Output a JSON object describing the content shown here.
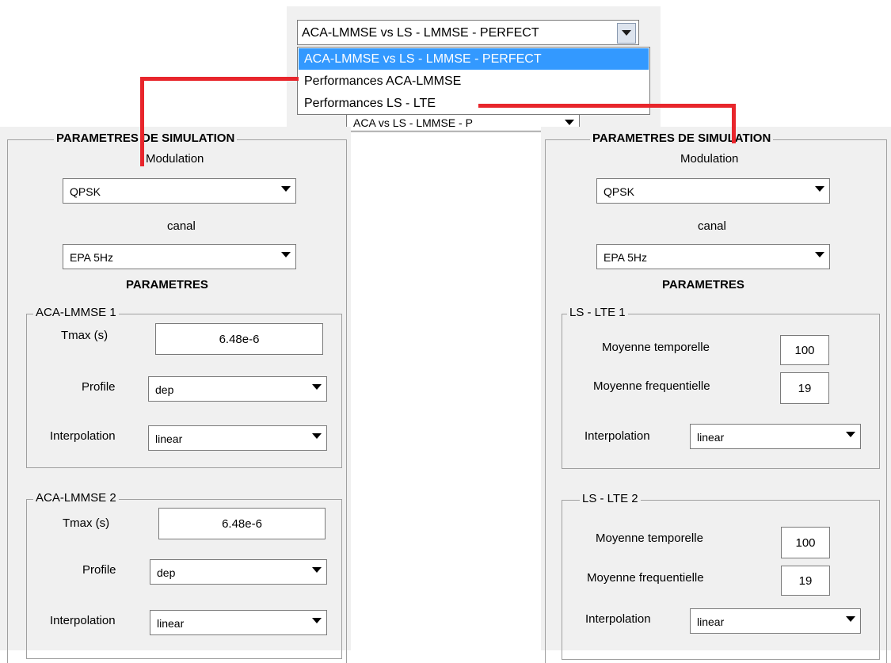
{
  "top_dropdown": {
    "selected": "ACA-LMMSE vs LS - LMMSE - PERFECT",
    "options": [
      "ACA-LMMSE vs LS - LMMSE - PERFECT",
      "Performances ACA-LMMSE",
      "Performances LS - LTE"
    ],
    "behind_combo": "ACA vs LS - LMMSE - P"
  },
  "left_panel": {
    "title": "PARAMETRES DE SIMULATION",
    "modulation_label": "Modulation",
    "modulation_value": "QPSK",
    "canal_label": "canal",
    "canal_value": "EPA 5Hz",
    "params_title": "PARAMETRES",
    "groups": [
      {
        "title": "ACA-LMMSE 1",
        "tmax_label": "Tmax (s)",
        "tmax_value": "6.48e-6",
        "profile_label": "Profile",
        "profile_value": "dep",
        "interp_label": "Interpolation",
        "interp_value": "linear"
      },
      {
        "title": "ACA-LMMSE 2",
        "tmax_label": "Tmax (s)",
        "tmax_value": "6.48e-6",
        "profile_label": "Profile",
        "profile_value": "dep",
        "interp_label": "Interpolation",
        "interp_value": "linear"
      }
    ]
  },
  "right_panel": {
    "title": "PARAMETRES DE SIMULATION",
    "modulation_label": "Modulation",
    "modulation_value": "QPSK",
    "canal_label": "canal",
    "canal_value": "EPA 5Hz",
    "params_title": "PARAMETRES",
    "groups": [
      {
        "title": "LS - LTE 1",
        "mt_label": "Moyenne temporelle",
        "mt_value": "100",
        "mf_label": "Moyenne frequentielle",
        "mf_value": "19",
        "interp_label": "Interpolation",
        "interp_value": "linear"
      },
      {
        "title": "LS - LTE 2",
        "mt_label": "Moyenne temporelle",
        "mt_value": "100",
        "mf_label": "Moyenne frequentielle",
        "mf_value": "19",
        "interp_label": "Interpolation",
        "interp_value": "linear"
      }
    ]
  },
  "colors": {
    "panel_bg": "#f0f0f0",
    "selection": "#3399ff",
    "connector": "#e8262c"
  }
}
